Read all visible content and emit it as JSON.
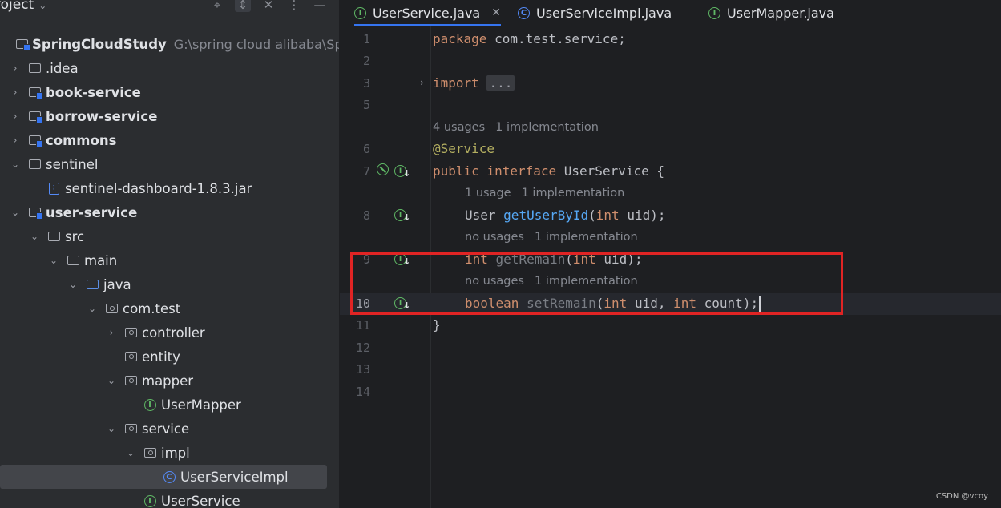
{
  "project_panel": {
    "title": "roject",
    "tree": [
      {
        "label": "SpringCloudStudy",
        "path": "G:\\spring cloud alibaba\\Sprin",
        "bold": true,
        "icon": "module-folder-icon"
      },
      {
        "label": ".idea",
        "icon": "folder-icon"
      },
      {
        "label": "book-service",
        "bold": true,
        "icon": "module-folder-icon"
      },
      {
        "label": "borrow-service",
        "bold": true,
        "icon": "module-folder-icon"
      },
      {
        "label": "commons",
        "bold": true,
        "icon": "module-folder-icon"
      },
      {
        "label": "sentinel",
        "icon": "folder-icon"
      },
      {
        "label": "sentinel-dashboard-1.8.3.jar",
        "icon": "jar-icon"
      },
      {
        "label": "user-service",
        "bold": true,
        "icon": "module-folder-icon"
      },
      {
        "label": "src",
        "icon": "folder-icon"
      },
      {
        "label": "main",
        "icon": "folder-icon"
      },
      {
        "label": "java",
        "icon": "source-folder-icon"
      },
      {
        "label": "com.test",
        "icon": "package-icon"
      },
      {
        "label": "controller",
        "icon": "package-icon"
      },
      {
        "label": "entity",
        "icon": "package-icon"
      },
      {
        "label": "mapper",
        "icon": "package-icon"
      },
      {
        "label": "UserMapper",
        "icon": "interface-icon"
      },
      {
        "label": "service",
        "icon": "package-icon"
      },
      {
        "label": "impl",
        "icon": "package-icon"
      },
      {
        "label": "UserServiceImpl",
        "icon": "class-icon"
      },
      {
        "label": "UserService",
        "icon": "interface-icon"
      }
    ]
  },
  "tabs": [
    {
      "label": "UserService.java",
      "icon": "interface-icon",
      "active": true,
      "close": "✕"
    },
    {
      "label": "UserServiceImpl.java",
      "icon": "class-icon"
    },
    {
      "label": "UserMapper.java",
      "icon": "interface-icon"
    }
  ],
  "editor": {
    "line_numbers": [
      "1",
      "2",
      "3",
      "5",
      "6",
      "7",
      "8",
      "9",
      "10",
      "11",
      "12",
      "13",
      "14"
    ],
    "code": {
      "l1_kw": "package",
      "l1_rest": " com.test.service;",
      "l3_kw": "import",
      "l3_fold": "...",
      "hint1_a": "4 usages",
      "hint1_b": "1 implementation",
      "l6_ann": "@Service",
      "l7_kw1": "public",
      "l7_kw2": "interface",
      "l7_rest": " UserService {",
      "hint2_a": "1 usage",
      "hint2_b": "1 implementation",
      "l8_type": "User ",
      "l8_fn": "getUserById",
      "l8_p1": "(",
      "l8_kw": "int",
      "l8_p2": " uid);",
      "hint3_a": "no usages",
      "hint3_b": "1 implementation",
      "l9_kw": "int",
      "l9_fn": " getRemain",
      "l9_p1": "(",
      "l9_kw2": "int",
      "l9_p2": " uid);",
      "hint4_a": "no usages",
      "hint4_b": "1 implementation",
      "l10_kw": "boolean",
      "l10_fn": " setRemain",
      "l10_p1": "(",
      "l10_kw2": "int",
      "l10_p2": " uid, ",
      "l10_kw3": "int",
      "l10_p3": " count);",
      "l11": "}"
    }
  },
  "highlight_color": "#e02424",
  "watermark": "CSDN @vcoy"
}
